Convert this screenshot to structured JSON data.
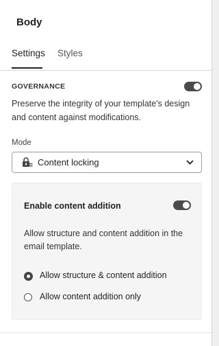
{
  "header": {
    "title": "Body"
  },
  "tabs": [
    {
      "label": "Settings",
      "active": true
    },
    {
      "label": "Styles",
      "active": false
    }
  ],
  "governance": {
    "label": "GOVERNANCE",
    "enabled": true,
    "description": "Preserve the integrity of your template's design and content against modifications."
  },
  "mode": {
    "label": "Mode",
    "selected": "Content locking",
    "icon": "lock-icon"
  },
  "content_addition": {
    "title": "Enable content addition",
    "enabled": true,
    "description": "Allow structure and content addition in the email template.",
    "options": [
      {
        "label": "Allow structure & content addition",
        "selected": true
      },
      {
        "label": "Allow content addition only",
        "selected": false
      }
    ]
  },
  "colors": {
    "toggle_on": "#4b4b4b",
    "text": "#222222",
    "card_bg": "#f5f5f5"
  }
}
